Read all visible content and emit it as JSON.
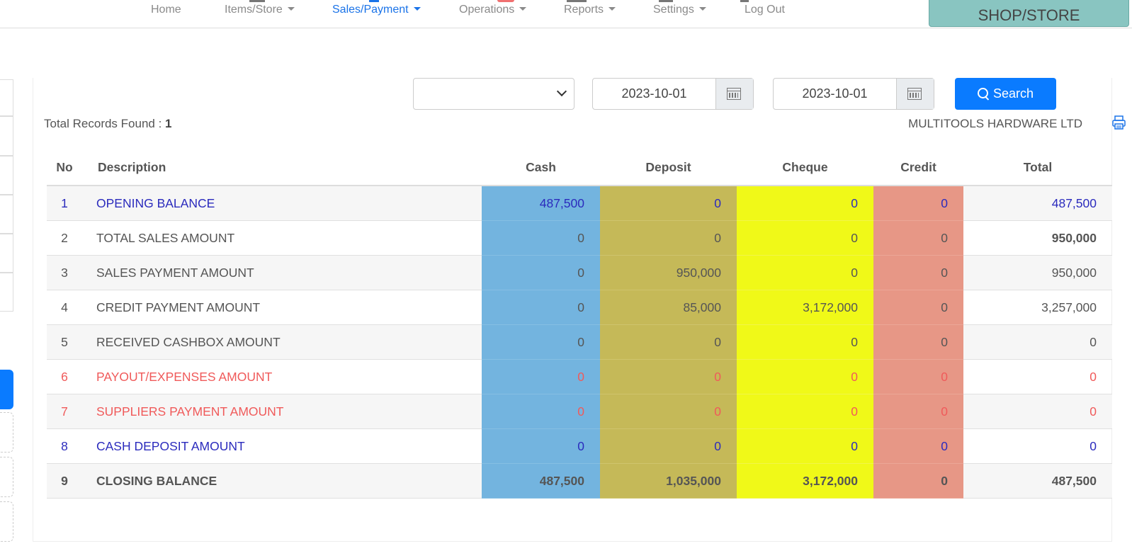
{
  "nav": {
    "items": [
      {
        "label": "Home",
        "dropdown": false
      },
      {
        "label": "Items/Store",
        "dropdown": true
      },
      {
        "label": "Sales/Payment",
        "dropdown": true,
        "active": true
      },
      {
        "label": "Operations",
        "dropdown": true
      },
      {
        "label": "Reports",
        "dropdown": true
      },
      {
        "label": "Settings",
        "dropdown": true
      },
      {
        "label": "Log Out",
        "dropdown": false
      }
    ],
    "shop_button": "SHOP/STORE"
  },
  "filters": {
    "select_value": "",
    "date_from": "2023-10-01",
    "date_to": "2023-10-01",
    "search_label": "Search"
  },
  "summary": {
    "records_label": "Total Records Found : ",
    "records_count": "1",
    "company": "MULTITOOLS HARDWARE LTD"
  },
  "table": {
    "headers": {
      "no": "No",
      "description": "Description",
      "cash": "Cash",
      "deposit": "Deposit",
      "cheque": "Cheque",
      "credit": "Credit",
      "total": "Total"
    },
    "rows": [
      {
        "no": "1",
        "description": "OPENING BALANCE",
        "cash": "487,500",
        "deposit": "0",
        "cheque": "0",
        "credit": "0",
        "total": "487,500"
      },
      {
        "no": "2",
        "description": "TOTAL SALES AMOUNT",
        "cash": "0",
        "deposit": "0",
        "cheque": "0",
        "credit": "0",
        "total": "950,000"
      },
      {
        "no": "3",
        "description": "SALES PAYMENT AMOUNT",
        "cash": "0",
        "deposit": "950,000",
        "cheque": "0",
        "credit": "0",
        "total": "950,000"
      },
      {
        "no": "4",
        "description": "CREDIT PAYMENT AMOUNT",
        "cash": "0",
        "deposit": "85,000",
        "cheque": "3,172,000",
        "credit": "0",
        "total": "3,257,000"
      },
      {
        "no": "5",
        "description": "RECEIVED CASHBOX AMOUNT",
        "cash": "0",
        "deposit": "0",
        "cheque": "0",
        "credit": "0",
        "total": "0"
      },
      {
        "no": "6",
        "description": "PAYOUT/EXPENSES AMOUNT",
        "cash": "0",
        "deposit": "0",
        "cheque": "0",
        "credit": "0",
        "total": "0"
      },
      {
        "no": "7",
        "description": "SUPPLIERS PAYMENT AMOUNT",
        "cash": "0",
        "deposit": "0",
        "cheque": "0",
        "credit": "0",
        "total": "0"
      },
      {
        "no": "8",
        "description": "CASH DEPOSIT AMOUNT",
        "cash": "0",
        "deposit": "0",
        "cheque": "0",
        "credit": "0",
        "total": "0"
      },
      {
        "no": "9",
        "description": "CLOSING BALANCE",
        "cash": "487,500",
        "deposit": "1,035,000",
        "cheque": "3,172,000",
        "credit": "0",
        "total": "487,500"
      }
    ]
  },
  "colors": {
    "accent": "#0a7bff",
    "cash_col": "#73b4df",
    "deposit_col": "#c5b958",
    "cheque_col": "#f0f918",
    "credit_col": "#e79786",
    "blue_text": "#2b2bbd",
    "red_text": "#f05a5a",
    "shop_button": "#89c5c1"
  },
  "icons": [
    "calendar-icon",
    "search-icon",
    "printer-icon",
    "chevron-down-icon",
    "caret-down-icon"
  ]
}
